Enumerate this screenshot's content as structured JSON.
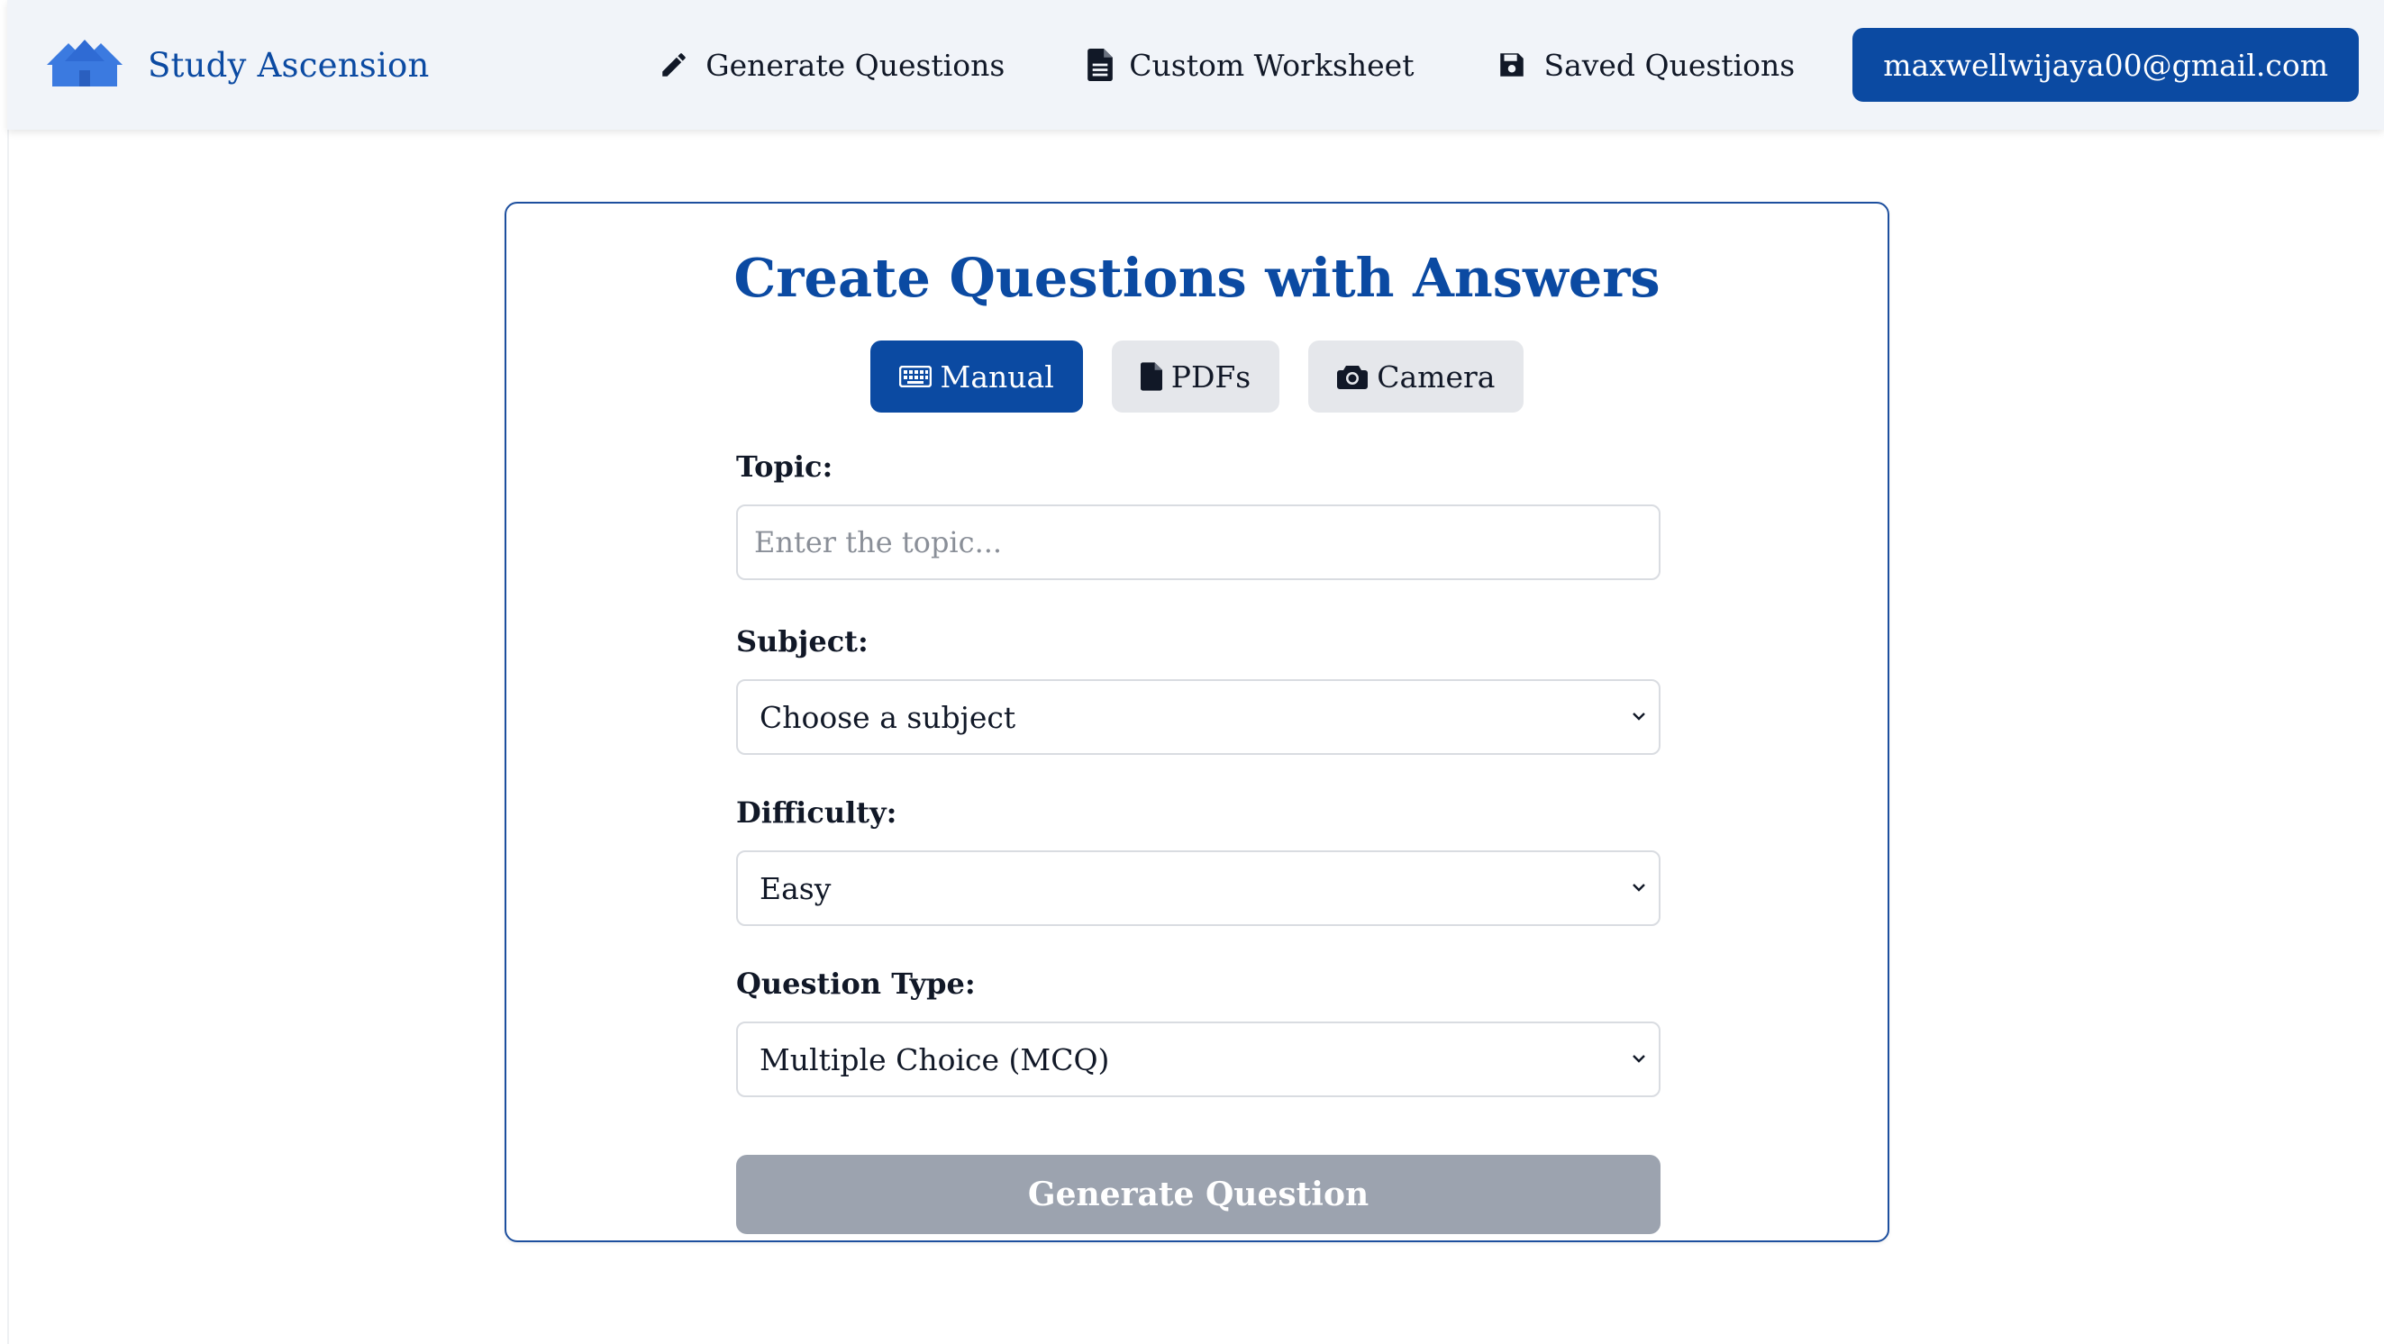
{
  "colors": {
    "brand": "#0b4aa2",
    "navbar_bg": "#f1f4f9",
    "tab_inactive_bg": "#e5e7eb",
    "button_disabled_bg": "#9ca3af",
    "logo": "#3b7ae0"
  },
  "navbar": {
    "brand_name": "Study Ascension",
    "brand_icon": "house-logo-icon",
    "links": [
      {
        "label": "Generate Questions",
        "icon": "pencil-icon"
      },
      {
        "label": "Custom Worksheet",
        "icon": "document-icon"
      },
      {
        "label": "Saved Questions",
        "icon": "floppy-disk-icon"
      }
    ],
    "user_email": "maxwellwijaya00@gmail.com"
  },
  "card": {
    "title": "Create Questions with Answers",
    "modes": [
      {
        "label": "Manual",
        "icon": "keyboard-icon",
        "active": true
      },
      {
        "label": "PDFs",
        "icon": "file-icon",
        "active": false
      },
      {
        "label": "Camera",
        "icon": "camera-icon",
        "active": false
      }
    ],
    "topic": {
      "label": "Topic:",
      "value": "",
      "placeholder": "Enter the topic..."
    },
    "subject": {
      "label": "Subject:",
      "selected": "Choose a subject"
    },
    "difficulty": {
      "label": "Difficulty:",
      "selected": "Easy"
    },
    "question_type": {
      "label": "Question Type:",
      "selected": "Multiple Choice (MCQ)"
    },
    "submit_label": "Generate Question"
  }
}
